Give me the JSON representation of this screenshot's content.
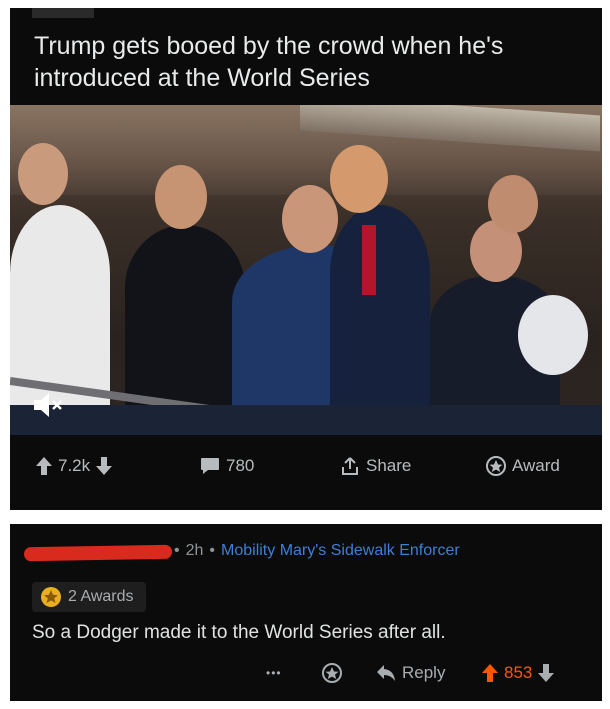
{
  "post": {
    "title": "Trump gets booed by the crowd when he's introduced at the World Series",
    "actions": {
      "upvotes": "7.2k",
      "comments": "780",
      "share": "Share",
      "award": "Award"
    }
  },
  "comment": {
    "time": "2h",
    "separator": "•",
    "flair": "Mobility Mary's Sidewalk Enforcer",
    "awards": "2 Awards",
    "text": "So a Dodger made it to the World Series after all.",
    "more": "•••",
    "reply": "Reply",
    "score": "853"
  },
  "colors": {
    "background": "#0b0b0b",
    "upvote_active": "#ff5700",
    "flair": "#3d7fd8",
    "redaction": "#d92b1d"
  },
  "icons": [
    "upvote-icon",
    "downvote-icon",
    "comment-icon",
    "share-icon",
    "award-icon",
    "mute-icon",
    "more-icon",
    "reply-icon"
  ]
}
